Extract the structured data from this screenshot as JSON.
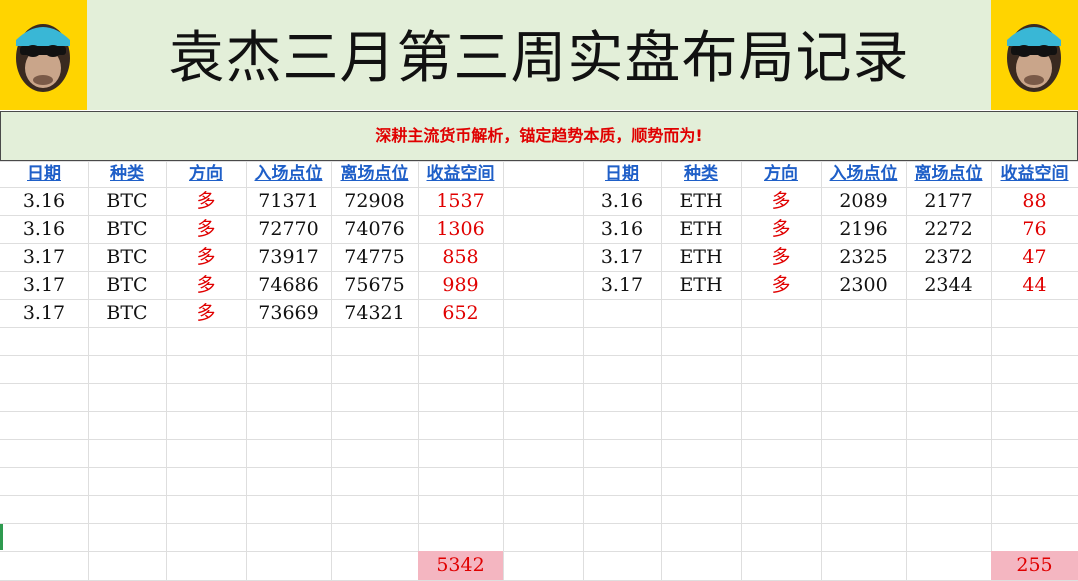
{
  "title": "袁杰三月第三周实盘布局记录",
  "subtitle": "深耕主流货币解析，锚定趋势本质，顺势而为!",
  "logo_icon": "monkey-with-sunglasses",
  "colors": {
    "header_bg": "#e3efd9",
    "logo_bg": "#ffd400",
    "header_text": "#1f5fc8",
    "accent_red": "#e00000",
    "total_bg": "#f4b6c1"
  },
  "columns": [
    "日期",
    "种类",
    "方向",
    "入场点位",
    "离场点位",
    "收益空间"
  ],
  "btc_rows": [
    [
      "3.16",
      "BTC",
      "多",
      "71371",
      "72908",
      "1537"
    ],
    [
      "3.16",
      "BTC",
      "多",
      "72770",
      "74076",
      "1306"
    ],
    [
      "3.17",
      "BTC",
      "多",
      "73917",
      "74775",
      "858"
    ],
    [
      "3.17",
      "BTC",
      "多",
      "74686",
      "75675",
      "989"
    ],
    [
      "3.17",
      "BTC",
      "多",
      "73669",
      "74321",
      "652"
    ]
  ],
  "btc_total": "5342",
  "eth_rows": [
    [
      "3.16",
      "ETH",
      "多",
      "2089",
      "2177",
      "88"
    ],
    [
      "3.16",
      "ETH",
      "多",
      "2196",
      "2272",
      "76"
    ],
    [
      "3.17",
      "ETH",
      "多",
      "2325",
      "2372",
      "47"
    ],
    [
      "3.17",
      "ETH",
      "多",
      "2300",
      "2344",
      "44"
    ]
  ],
  "eth_total": "255"
}
